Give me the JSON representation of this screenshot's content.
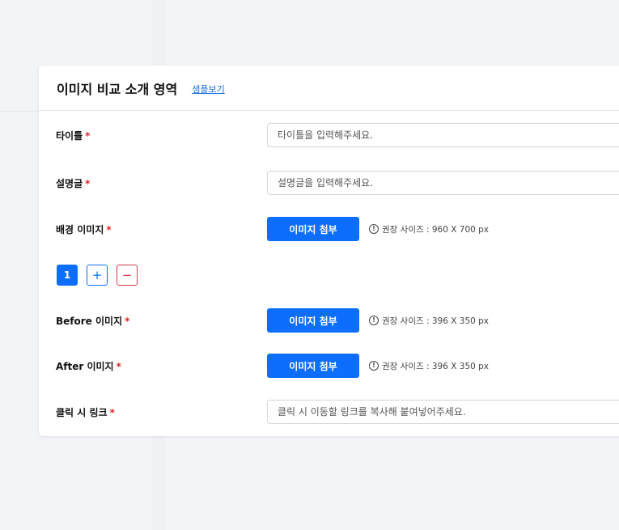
{
  "card": {
    "title": "이미지 비교 소개 영역",
    "sample_link": "샘플보기"
  },
  "required_mark": "*",
  "fields": {
    "title": {
      "label": "타이틀",
      "placeholder": "타이틀을 입력해주세요."
    },
    "description": {
      "label": "설명글",
      "placeholder": "설명글을 입력해주세요."
    },
    "background_image": {
      "label": "배경 이미지",
      "button": "이미지 첨부",
      "hint": "권장 사이즈 : 960 X 700 px"
    },
    "before_image": {
      "label": "Before 이미지",
      "button": "이미지 첨부",
      "hint": "권장 사이즈 : 396 X 350 px"
    },
    "after_image": {
      "label": "After 이미지",
      "button": "이미지 첨부",
      "hint": "권장 사이즈 : 396 X 350 px"
    },
    "click_link": {
      "label": "클릭 시 링크",
      "placeholder": "클릭 시 이동할 링크를 복사해 붙여넣어주세요."
    }
  },
  "pager": {
    "current": "1",
    "add_symbol": "+",
    "remove_symbol": "−"
  },
  "icons": {
    "info": "info-icon"
  },
  "colors": {
    "primary": "#0d6efd",
    "danger": "#d9364a",
    "required": "#e02424",
    "link": "#1a6fe6",
    "background": "#f3f4f7"
  }
}
